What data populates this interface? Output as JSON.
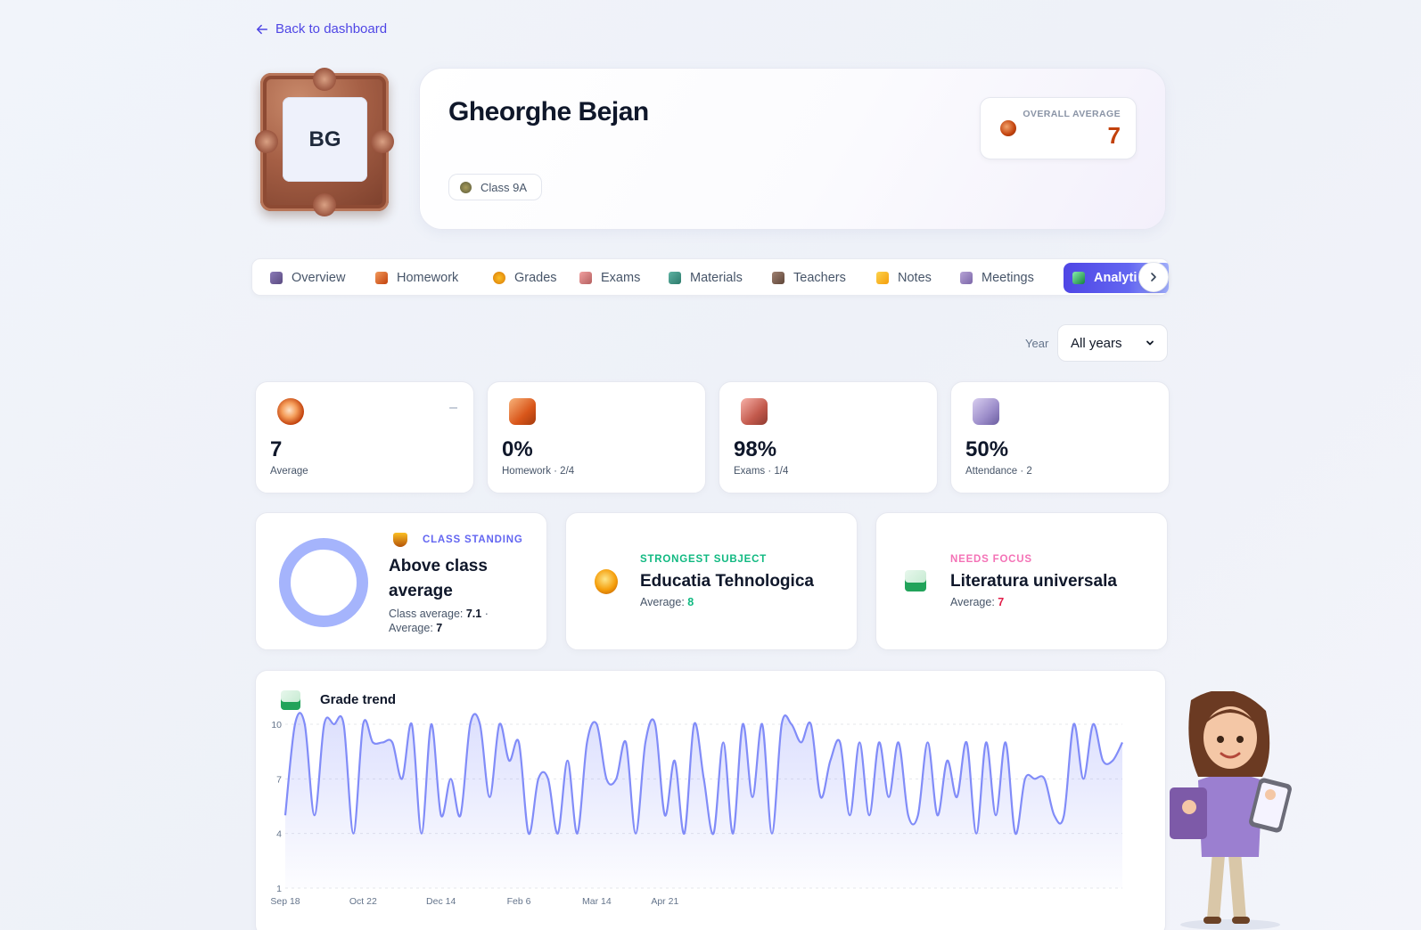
{
  "nav": {
    "back_label": "Back to dashboard"
  },
  "profile": {
    "initials": "BG",
    "name": "Gheorghe Bejan",
    "class_label": "Class 9A",
    "overall_average_label": "OVERALL AVERAGE",
    "overall_average_value": "7"
  },
  "tabs": [
    {
      "label": "Overview",
      "icon": "overview-icon",
      "active": false
    },
    {
      "label": "Homework",
      "icon": "homework-icon",
      "active": false
    },
    {
      "label": "Grades",
      "icon": "grades-icon",
      "active": false
    },
    {
      "label": "Exams",
      "icon": "exams-icon",
      "active": false
    },
    {
      "label": "Materials",
      "icon": "materials-icon",
      "active": false
    },
    {
      "label": "Teachers",
      "icon": "teachers-icon",
      "active": false
    },
    {
      "label": "Notes",
      "icon": "notes-icon",
      "active": false
    },
    {
      "label": "Meetings",
      "icon": "meetings-icon",
      "active": false
    },
    {
      "label": "Analyti",
      "icon": "analytics-icon",
      "active": true
    }
  ],
  "filters": {
    "year_label": "Year",
    "year_value": "All years"
  },
  "stats": [
    {
      "value": "7",
      "label": "Average",
      "icon": "gauge-icon",
      "trend": "–"
    },
    {
      "value": "0%",
      "label": "Homework · 2/4",
      "icon": "homework-icon"
    },
    {
      "value": "98%",
      "label": "Exams · 1/4",
      "icon": "clipboard-icon"
    },
    {
      "value": "50%",
      "label": "Attendance · 2",
      "icon": "calendar-icon"
    }
  ],
  "insights": {
    "standing": {
      "eyebrow": "CLASS STANDING",
      "title_line1": "Above class",
      "title_line2": "average",
      "class_avg_label": "Class average:",
      "class_avg_value": "7.1",
      "sep": " ·",
      "avg_label": "Average:",
      "avg_value": "7",
      "icon": "trophy-icon"
    },
    "strongest": {
      "eyebrow": "STRONGEST SUBJECT",
      "title": "Educatia Tehnologica",
      "avg_label": "Average:",
      "avg_value": "8",
      "icon": "medal-icon"
    },
    "focus": {
      "eyebrow": "NEEDS FOCUS",
      "title": "Literatura universala",
      "avg_label": "Average:",
      "avg_value": "7",
      "icon": "chart-up-icon"
    }
  },
  "colors": {
    "accent": "#4f46e5",
    "line": "#818cf8",
    "ring": "#a5b4fc",
    "strong": "#10b981",
    "focus": "#f472b6",
    "focus_value": "#e11d48",
    "average": "#c2410c"
  },
  "chart_data": {
    "type": "line",
    "title": "Grade trend",
    "ylim": [
      1,
      10
    ],
    "y_ticks": [
      1,
      4,
      7,
      10
    ],
    "x_tick_labels": [
      "Sep 18",
      "Oct 22",
      "Dec 14",
      "Feb 6",
      "Mar 14",
      "Apr 21"
    ],
    "x_tick_index": [
      0,
      8,
      16,
      24,
      32,
      39
    ],
    "series": [
      {
        "values": [
          5,
          10,
          10,
          5,
          10,
          10,
          10,
          4,
          10,
          9,
          9,
          9,
          7,
          10,
          4,
          10,
          5,
          7,
          5,
          10,
          10,
          6,
          10,
          8,
          9,
          4,
          7,
          7,
          4,
          8,
          4,
          9,
          10,
          7,
          7,
          9,
          4,
          9,
          10,
          5,
          8,
          4,
          10,
          7,
          4,
          9,
          4,
          10,
          6,
          10,
          4,
          10,
          10,
          9,
          10,
          6,
          8,
          9,
          5,
          9,
          5,
          9,
          6,
          9,
          5,
          5,
          9,
          5,
          8,
          6,
          9,
          4,
          9,
          5,
          9,
          4,
          7,
          7,
          7,
          5,
          5,
          10,
          7,
          10,
          8,
          8,
          9
        ]
      }
    ]
  }
}
